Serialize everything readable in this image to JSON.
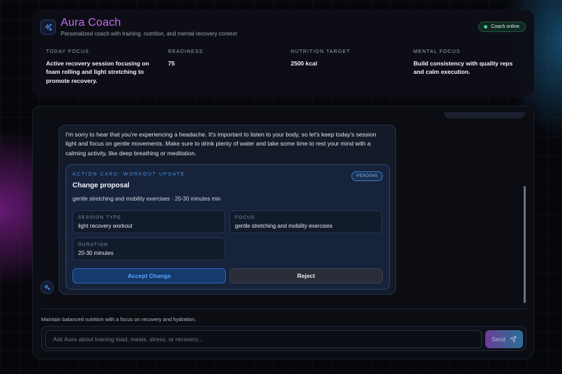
{
  "header": {
    "title": "Aura Coach",
    "subtitle": "Personalized coach with training, nutrition, and mental recovery context",
    "logo_icon": "sparkles-icon",
    "status": "Coach online",
    "status_color": "#3fd08b",
    "accent_color": "#c36ef0"
  },
  "metrics": [
    {
      "label": "TODAY FOCUS",
      "value": "Active recovery session focusing on foam rolling and light stretching to promote recovery."
    },
    {
      "label": "READINESS",
      "value": "75"
    },
    {
      "label": "NUTRITION TARGET",
      "value": "2500 kcal"
    },
    {
      "label": "MENTAL FOCUS",
      "value": "Build consistency with quality reps and calm execution."
    }
  ],
  "chat": {
    "message": "I'm sorry to hear that you're experiencing a headache. It's important to listen to your body, so let's keep today's session light and focus on gentle movements. Make sure to drink plenty of water and take some time to rest your mind with a calming activity, like deep breathing or meditation.",
    "action_card": {
      "eyebrow": "ACTION CARD: WORKOUT UPDATE",
      "status": "PENDING",
      "title": "Change proposal",
      "summary": "gentle stretching and mobility exercises · 20-30 minutes min",
      "fields": [
        {
          "label": "SESSION TYPE",
          "value": "light recovery workout"
        },
        {
          "label": "FOCUS",
          "value": "gentle stretching and mobility exercises"
        },
        {
          "label": "DURATION",
          "value": "20-30 minutes"
        }
      ],
      "accept_label": "Accept Change",
      "reject_label": "Reject"
    },
    "hint": "Maintain balanced nutrition with a focus on recovery and hydration.",
    "input_placeholder": "Ask Aura about training load, meals, stress, or recovery...",
    "input_value": "",
    "send_label": "Send",
    "send_icon": "paper-plane-icon"
  }
}
